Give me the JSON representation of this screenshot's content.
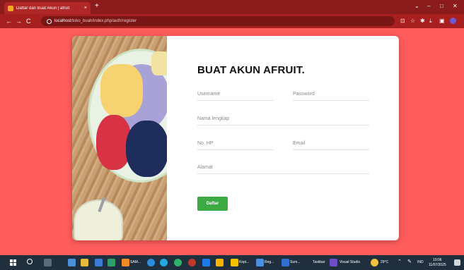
{
  "browser": {
    "tab_title": "Daftar dan Buat Akun | afruit",
    "tab_close": "×",
    "new_tab": "+",
    "controls": {
      "minimize": "–",
      "maximize": "□",
      "close": "✕",
      "collapse": "⌄"
    },
    "nav": {
      "back": "←",
      "forward": "→",
      "reload": "C"
    },
    "url_host": "localhost",
    "url_path": "/toko_buah/index.php/auth/register",
    "toolbar_icons": [
      "install-icon",
      "star-icon",
      "extensions-icon",
      "download-icon",
      "sidebar-icon",
      "profile-icon"
    ]
  },
  "form": {
    "heading": "BUAT AKUN AFRUIT.",
    "fields": {
      "username": "Username",
      "password": "Password",
      "nama_lengkap": "Nama lengkap",
      "no_hp": "No. HP",
      "email": "Email",
      "alamat": "Alamat"
    },
    "submit_label": "Daftar"
  },
  "taskbar": {
    "items": [
      "SAM...",
      "Kopi...",
      "Reg...",
      "Sum...",
      "Visual Studio"
    ],
    "search_label": "Taskbar",
    "weather": "29°C",
    "language": "IND",
    "time": "19:06",
    "date": "11/07/2025"
  },
  "colors": {
    "page_bg": "#ff5c5c",
    "browser_tab_bg": "#8c1c1c",
    "submit_button": "#3cab43",
    "taskbar_bg": "#1f2f3d"
  }
}
